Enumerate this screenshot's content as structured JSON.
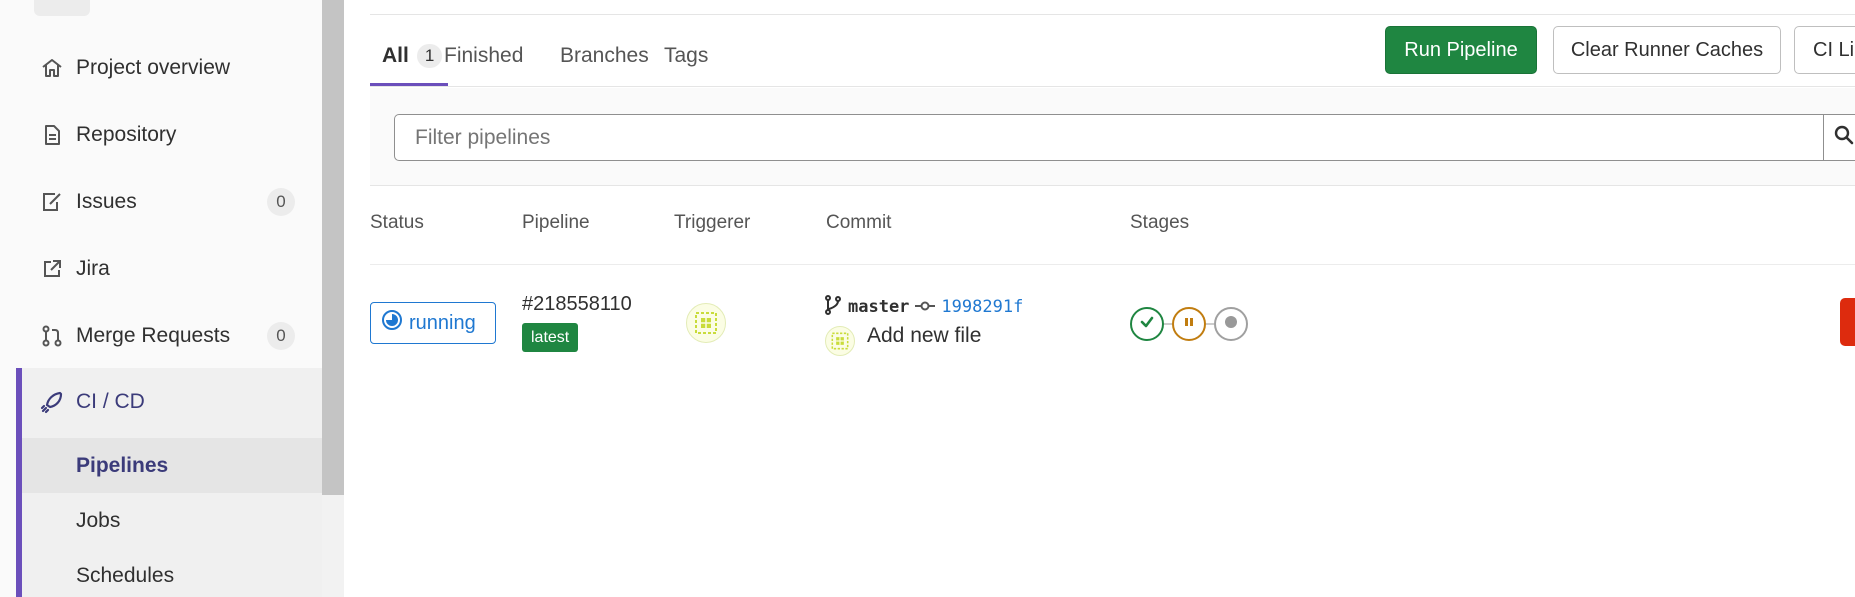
{
  "sidebar": {
    "items": [
      {
        "label": "Project overview",
        "icon": "home-icon"
      },
      {
        "label": "Repository",
        "icon": "document-icon"
      },
      {
        "label": "Issues",
        "icon": "issues-icon",
        "count": "0"
      },
      {
        "label": "Jira",
        "icon": "external-link-icon"
      },
      {
        "label": "Merge Requests",
        "icon": "merge-request-icon",
        "count": "0"
      },
      {
        "label": "CI / CD",
        "icon": "rocket-icon"
      }
    ],
    "cicd_sub": [
      {
        "label": "Pipelines",
        "active": true
      },
      {
        "label": "Jobs"
      },
      {
        "label": "Schedules"
      }
    ]
  },
  "tabs": [
    {
      "label": "All",
      "count": "1",
      "active": true
    },
    {
      "label": "Finished"
    },
    {
      "label": "Branches"
    },
    {
      "label": "Tags"
    }
  ],
  "actions": {
    "run_pipeline": "Run Pipeline",
    "clear_caches": "Clear Runner Caches",
    "ci_lint": "CI Lint"
  },
  "filter": {
    "placeholder": "Filter pipelines"
  },
  "table": {
    "columns": [
      "Status",
      "Pipeline",
      "Triggerer",
      "Commit",
      "Stages"
    ],
    "rows": [
      {
        "status": "running",
        "pipeline_id": "#218558110",
        "badge": "latest",
        "branch": "master",
        "sha": "1998291f",
        "commit_title": "Add new file",
        "stages": [
          "passed",
          "manual",
          "created"
        ]
      }
    ]
  },
  "colors": {
    "accent": "#6b4fbb",
    "success": "#1f8641",
    "running": "#1f78d1",
    "manual": "#c17d10",
    "danger": "#dd2b0e"
  }
}
